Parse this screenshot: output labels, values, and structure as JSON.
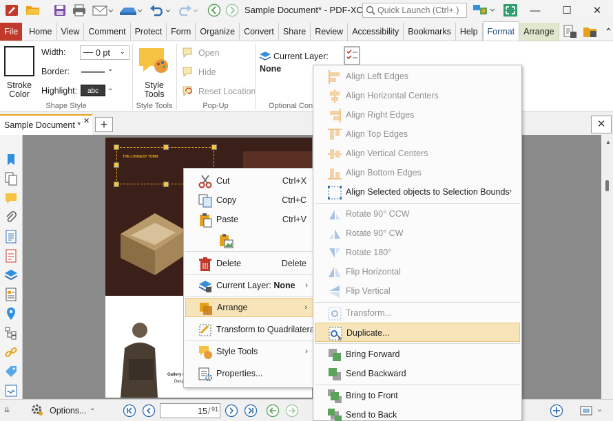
{
  "titlebar": {
    "doc_title": "Sample Document* - PDF-XCh...",
    "quick_launch_placeholder": "Quick Launch (Ctrl+.)"
  },
  "ribbon_tabs": [
    "File",
    "Home",
    "View",
    "Comment",
    "Protect",
    "Form",
    "Organize",
    "Convert",
    "Share",
    "Review",
    "Accessibility",
    "Bookmarks",
    "Help",
    "Format",
    "Arrange"
  ],
  "ribbon": {
    "stroke_color": "Stroke\nColor",
    "width_label": "Width:",
    "width_value": "0 pt",
    "border_label": "Border:",
    "highlight_label": "Highlight:",
    "highlight_value": "abc",
    "shape_style": "Shape Style",
    "style_tools": "Style\nTools",
    "style_tools_group": "Style Tools",
    "open": "Open",
    "hide": "Hide",
    "reset_location": "Reset Location",
    "popup_group": "Pop-Up",
    "current_layer": "Current Layer:",
    "layer_value": "None",
    "optional_group": "Optional Con"
  },
  "doc_tab": "Sample Document *",
  "context_menu": {
    "cut": "Cut",
    "cut_sc": "Ctrl+X",
    "copy": "Copy",
    "copy_sc": "Ctrl+C",
    "paste": "Paste",
    "paste_sc": "Ctrl+V",
    "delete": "Delete",
    "delete_sc": "Delete",
    "current_layer": "Current Layer: ",
    "current_layer_value": "None",
    "arrange": "Arrange",
    "transform_quad": "Transform to Quadrilateral",
    "style_tools": "Style Tools",
    "properties": "Properties..."
  },
  "submenu": [
    {
      "label": "Align Left Edges",
      "enabled": false
    },
    {
      "label": "Align Horizontal Centers",
      "enabled": false
    },
    {
      "label": "Align Right Edges",
      "enabled": false
    },
    {
      "label": "Align Top Edges",
      "enabled": false
    },
    {
      "label": "Align Vertical Centers",
      "enabled": false
    },
    {
      "label": "Align Bottom Edges",
      "enabled": false
    },
    {
      "label": "Align Selected objects to Selection Bounds",
      "enabled": true
    },
    {
      "label": "Rotate 90° CCW",
      "enabled": false
    },
    {
      "label": "Rotate 90° CW",
      "enabled": false
    },
    {
      "label": "Rotate 180°",
      "enabled": false
    },
    {
      "label": "Flip Horizontal",
      "enabled": false
    },
    {
      "label": "Flip Vertical",
      "enabled": false
    },
    {
      "label": "Transform...",
      "enabled": false
    },
    {
      "label": "Duplicate...",
      "enabled": true
    },
    {
      "label": "Bring Forward",
      "enabled": true
    },
    {
      "label": "Send Backward",
      "enabled": true
    },
    {
      "label": "Bring to Front",
      "enabled": true
    },
    {
      "label": "Send to Back",
      "enabled": true
    }
  ],
  "page_text": {
    "heading": "THE LONGEST TOMB",
    "caption": "Gallery o",
    "caption2": "Despi"
  },
  "statusbar": {
    "options": "Options...",
    "page_current": "15",
    "page_total": "91"
  },
  "colors": {
    "accent": "#e8a21a",
    "file_tab": "#c0392b",
    "highlight": "#f7e4b8",
    "active_tab_text": "#1f4e79"
  }
}
